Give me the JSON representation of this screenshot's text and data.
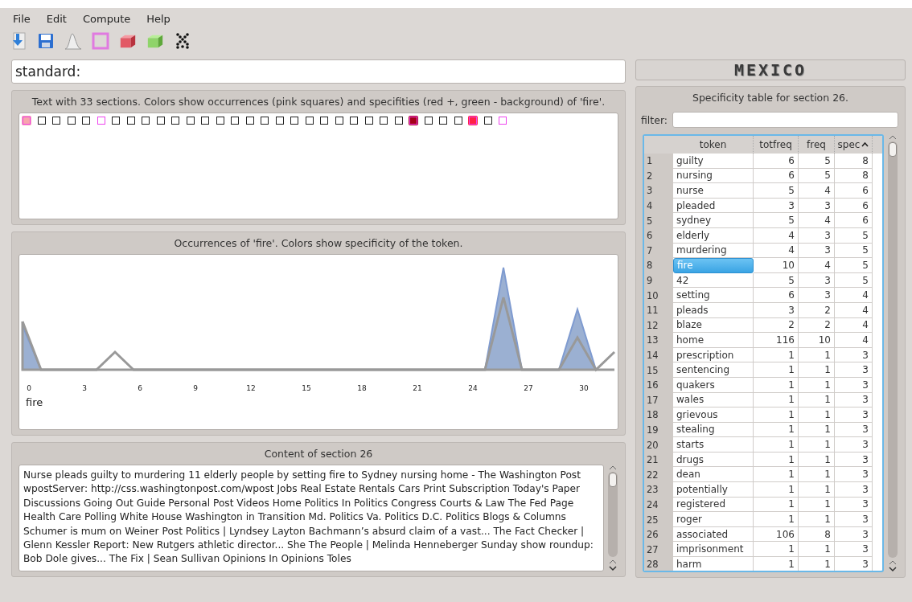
{
  "menu": [
    {
      "label": "File"
    },
    {
      "label": "Edit"
    },
    {
      "label": "Compute"
    },
    {
      "label": "Help"
    }
  ],
  "toolbar": [
    {
      "kind": "import"
    },
    {
      "kind": "save"
    },
    {
      "kind": "curve"
    },
    {
      "kind": "square"
    },
    {
      "kind": "red-cube"
    },
    {
      "kind": "green-cube"
    },
    {
      "kind": "dots"
    }
  ],
  "query": {
    "value": "standard:"
  },
  "logo": {
    "text": "MEXICO"
  },
  "sections_panel": {
    "title": "Text with 33 sections. Colors show occurrences (pink squares) and specifities (red +, green - background) of 'fire'.",
    "sections": [
      {
        "occurs": true,
        "color": "#f7a5ad"
      },
      {
        "occurs": false
      },
      {
        "occurs": false
      },
      {
        "occurs": false
      },
      {
        "occurs": false
      },
      {
        "occurs": true
      },
      {
        "occurs": false
      },
      {
        "occurs": false
      },
      {
        "occurs": false
      },
      {
        "occurs": false
      },
      {
        "occurs": false
      },
      {
        "occurs": false
      },
      {
        "occurs": false
      },
      {
        "occurs": false
      },
      {
        "occurs": false
      },
      {
        "occurs": false
      },
      {
        "occurs": false
      },
      {
        "occurs": false
      },
      {
        "occurs": false
      },
      {
        "occurs": false
      },
      {
        "occurs": false
      },
      {
        "occurs": false
      },
      {
        "occurs": false
      },
      {
        "occurs": false
      },
      {
        "occurs": false
      },
      {
        "occurs": false
      },
      {
        "occurs": true,
        "color": "#a50019"
      },
      {
        "occurs": false
      },
      {
        "occurs": false
      },
      {
        "occurs": false
      },
      {
        "occurs": true,
        "color": "#ff2244"
      },
      {
        "occurs": false
      },
      {
        "occurs": true
      }
    ]
  },
  "occurrence_panel": {
    "title": "Occurrences of 'fire'. Colors show specificity of the token.",
    "xticks": [
      "0",
      "3",
      "6",
      "9",
      "12",
      "15",
      "18",
      "21",
      "24",
      "27",
      "30"
    ],
    "legend": "fire"
  },
  "content_panel": {
    "title": "Content of section 26",
    "text": "Nurse pleads guilty to murdering 11 elderly people by setting fire to Sydney nursing home - The Washington Post wpostServer: http://css.washingtonpost.com/wpost Jobs Real Estate Rentals Cars Print Subscription Today's Paper Discussions Going Out Guide Personal Post Videos Home Politics In Politics Congress Courts & Law The Fed Page Health Care Polling White House Washington in Transition Md. Politics Va. Politics D.C. Politics Blogs & Columns Schumer is mum on Weiner Post Politics | Lyndsey Layton Bachmann’s absurd claim of a vast... The Fact Checker | Glenn Kessler Report: New Rutgers athletic director... She The People | Melinda Henneberger Sunday show roundup: Bob Dole gives... The Fix | Sean Sullivan Opinions In Opinions Toles"
  },
  "table_panel": {
    "title": "Specificity table for section 26.",
    "filter_label": "filter:",
    "columns": [
      "token",
      "totfreq",
      "freq",
      "spec"
    ],
    "rows": [
      {
        "n": "1",
        "token": "guilty",
        "totfreq": "6",
        "freq": "5",
        "spec": "8",
        "selected": false
      },
      {
        "n": "2",
        "token": "nursing",
        "totfreq": "6",
        "freq": "5",
        "spec": "8",
        "selected": false
      },
      {
        "n": "3",
        "token": "nurse",
        "totfreq": "5",
        "freq": "4",
        "spec": "6",
        "selected": false
      },
      {
        "n": "4",
        "token": "pleaded",
        "totfreq": "3",
        "freq": "3",
        "spec": "6",
        "selected": false
      },
      {
        "n": "5",
        "token": "sydney",
        "totfreq": "5",
        "freq": "4",
        "spec": "6",
        "selected": false
      },
      {
        "n": "6",
        "token": "elderly",
        "totfreq": "4",
        "freq": "3",
        "spec": "5",
        "selected": false
      },
      {
        "n": "7",
        "token": "murdering",
        "totfreq": "4",
        "freq": "3",
        "spec": "5",
        "selected": false
      },
      {
        "n": "8",
        "token": "fire",
        "totfreq": "10",
        "freq": "4",
        "spec": "5",
        "selected": true
      },
      {
        "n": "9",
        "token": "42",
        "totfreq": "5",
        "freq": "3",
        "spec": "5",
        "selected": false
      },
      {
        "n": "10",
        "token": "setting",
        "totfreq": "6",
        "freq": "3",
        "spec": "4",
        "selected": false
      },
      {
        "n": "11",
        "token": "pleads",
        "totfreq": "3",
        "freq": "2",
        "spec": "4",
        "selected": false
      },
      {
        "n": "12",
        "token": "blaze",
        "totfreq": "2",
        "freq": "2",
        "spec": "4",
        "selected": false
      },
      {
        "n": "13",
        "token": "home",
        "totfreq": "116",
        "freq": "10",
        "spec": "4",
        "selected": false
      },
      {
        "n": "14",
        "token": "prescription",
        "totfreq": "1",
        "freq": "1",
        "spec": "3",
        "selected": false
      },
      {
        "n": "15",
        "token": "sentencing",
        "totfreq": "1",
        "freq": "1",
        "spec": "3",
        "selected": false
      },
      {
        "n": "16",
        "token": "quakers",
        "totfreq": "1",
        "freq": "1",
        "spec": "3",
        "selected": false
      },
      {
        "n": "17",
        "token": "wales",
        "totfreq": "1",
        "freq": "1",
        "spec": "3",
        "selected": false
      },
      {
        "n": "18",
        "token": "grievous",
        "totfreq": "1",
        "freq": "1",
        "spec": "3",
        "selected": false
      },
      {
        "n": "19",
        "token": "stealing",
        "totfreq": "1",
        "freq": "1",
        "spec": "3",
        "selected": false
      },
      {
        "n": "20",
        "token": "starts",
        "totfreq": "1",
        "freq": "1",
        "spec": "3",
        "selected": false
      },
      {
        "n": "21",
        "token": "drugs",
        "totfreq": "1",
        "freq": "1",
        "spec": "3",
        "selected": false
      },
      {
        "n": "22",
        "token": "dean",
        "totfreq": "1",
        "freq": "1",
        "spec": "3",
        "selected": false
      },
      {
        "n": "23",
        "token": "potentially",
        "totfreq": "1",
        "freq": "1",
        "spec": "3",
        "selected": false
      },
      {
        "n": "24",
        "token": "registered",
        "totfreq": "1",
        "freq": "1",
        "spec": "3",
        "selected": false
      },
      {
        "n": "25",
        "token": "roger",
        "totfreq": "1",
        "freq": "1",
        "spec": "3",
        "selected": false
      },
      {
        "n": "26",
        "token": "associated",
        "totfreq": "106",
        "freq": "8",
        "spec": "3",
        "selected": false
      },
      {
        "n": "27",
        "token": "imprisonment",
        "totfreq": "1",
        "freq": "1",
        "spec": "3",
        "selected": false
      },
      {
        "n": "28",
        "token": "harm",
        "totfreq": "1",
        "freq": "1",
        "spec": "3",
        "selected": false
      }
    ]
  }
}
